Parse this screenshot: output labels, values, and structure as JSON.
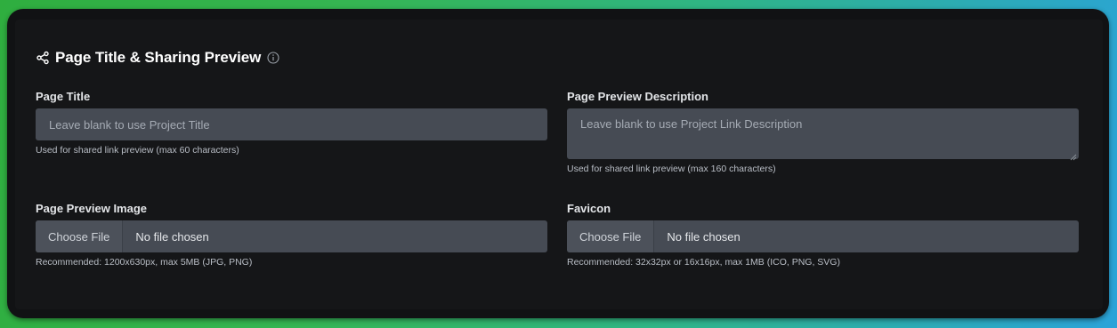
{
  "section": {
    "title": "Page Title & Sharing Preview",
    "share_icon": "share-icon",
    "info_icon": "info-icon"
  },
  "fields": {
    "page_title": {
      "label": "Page Title",
      "placeholder": "Leave blank to use Project Title",
      "hint": "Used for shared link preview (max 60 characters)"
    },
    "preview_description": {
      "label": "Page Preview Description",
      "placeholder": "Leave blank to use Project Link Description",
      "hint": "Used for shared link preview (max 160 characters)"
    },
    "preview_image": {
      "label": "Page Preview Image",
      "button_label": "Choose File",
      "status": "No file chosen",
      "hint": "Recommended: 1200x630px, max 5MB (JPG, PNG)"
    },
    "favicon": {
      "label": "Favicon",
      "button_label": "Choose File",
      "status": "No file chosen",
      "hint": "Recommended: 32x32px or 16x16px, max 1MB (ICO, PNG, SVG)"
    }
  },
  "colors": {
    "background": "#151618",
    "input": "#464b54",
    "text": "#ffffff"
  }
}
